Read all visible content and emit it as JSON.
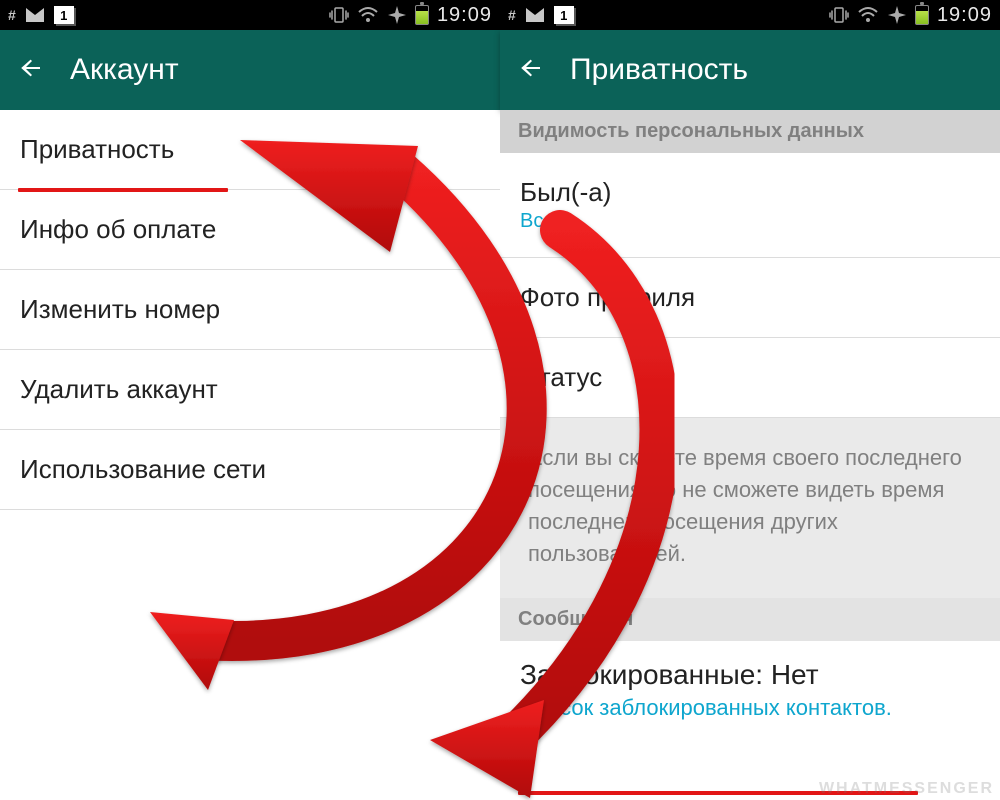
{
  "status": {
    "hash": "#",
    "num_badge": "1",
    "time": "19:09"
  },
  "left": {
    "header_title": "Аккаунт",
    "items": [
      {
        "label": "Приватность"
      },
      {
        "label": "Инфо об оплате"
      },
      {
        "label": "Изменить номер"
      },
      {
        "label": "Удалить аккаунт"
      },
      {
        "label": "Использование сети"
      }
    ]
  },
  "right": {
    "header_title": "Приватность",
    "section1": "Видимость персональных данных",
    "items": [
      {
        "label": "Был(-а)",
        "sub": "Все"
      },
      {
        "label": "Фото профиля"
      },
      {
        "label": "Статус"
      }
    ],
    "info": "Если вы скроете время своего последнего посещения, то не сможете видеть время последнего посещения других пользователей.",
    "section2": "Сообщения",
    "blocked_title": "Заблокированные: Нет",
    "blocked_sub": "Список заблокированных контактов."
  },
  "watermark": "WHATMESSENGER",
  "colors": {
    "header": "#0b6258",
    "accent": "#0ea6ce",
    "underline": "#e21616"
  }
}
